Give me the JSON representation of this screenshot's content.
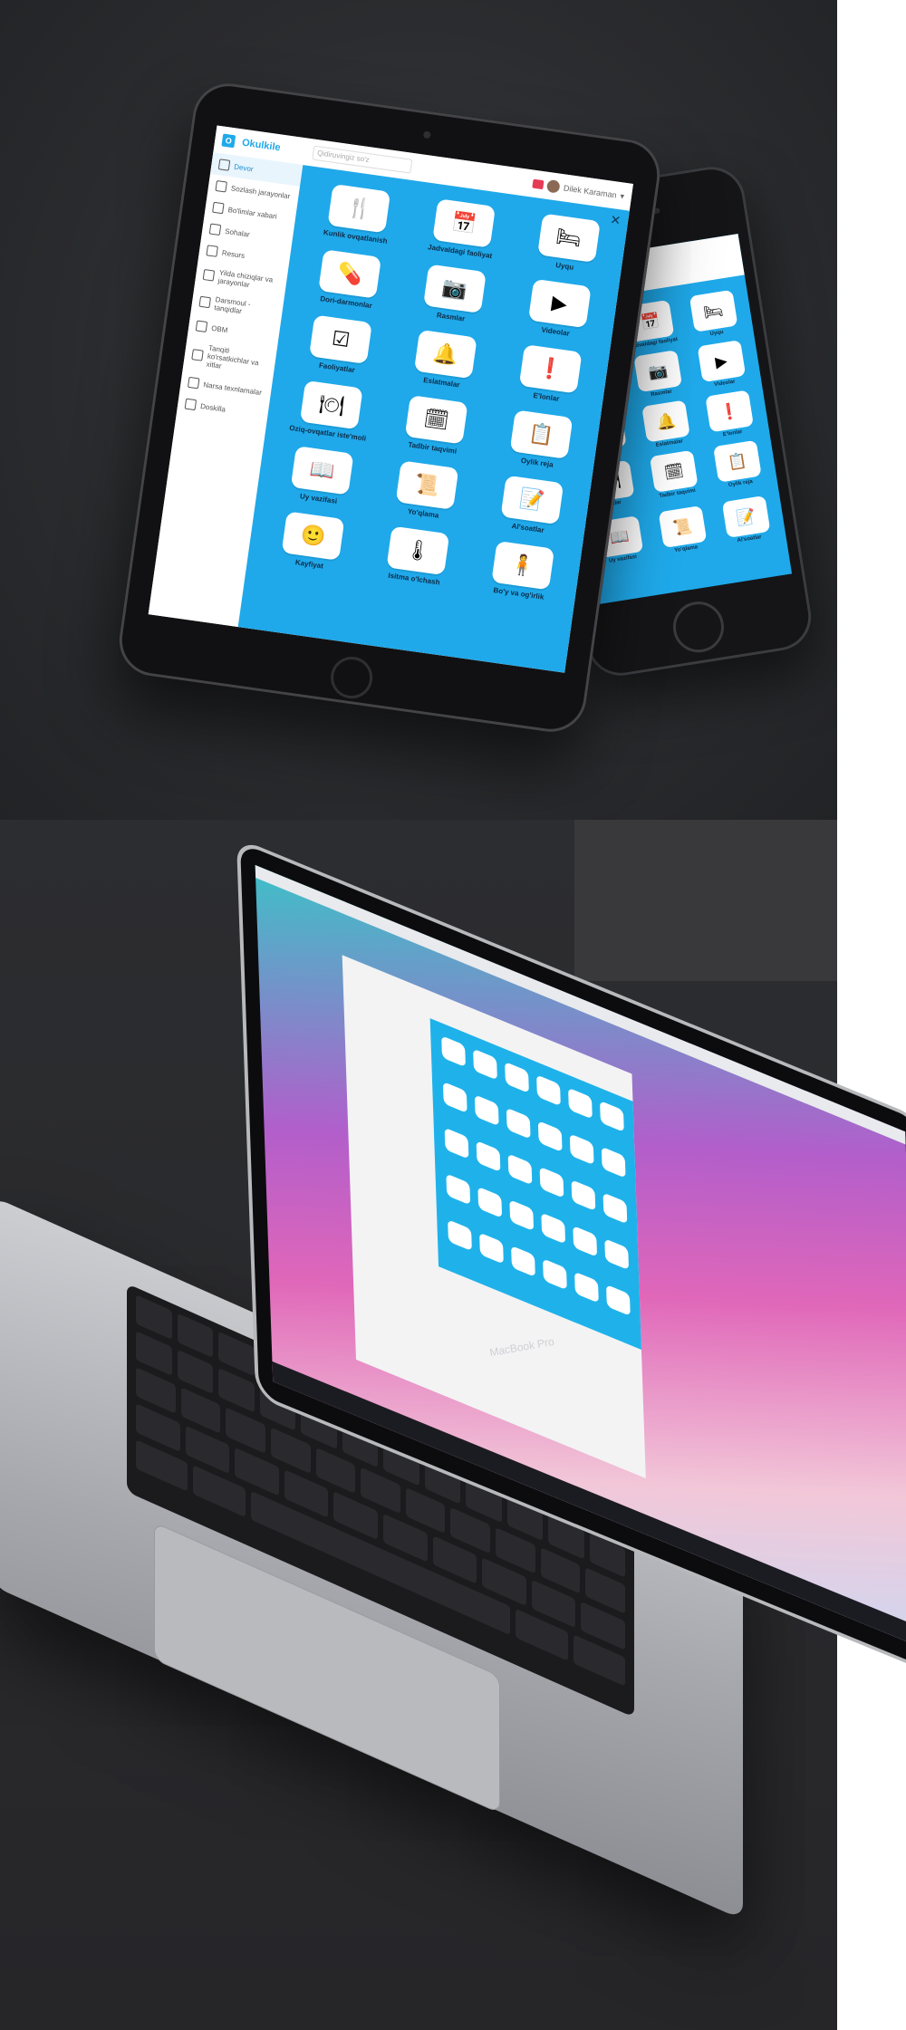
{
  "header": {
    "logo_text": "Okulkile",
    "search_placeholder": "Qidiruvingiz so'z",
    "user_name": "Dilek Karaman"
  },
  "sidebar": {
    "items": [
      {
        "label": "Devor",
        "icon": "wall-icon"
      },
      {
        "label": "Sozlash jarayonlar",
        "icon": "gear-icon"
      },
      {
        "label": "Bo'limlar xabari",
        "icon": "bell-icon"
      },
      {
        "label": "Sohalar",
        "icon": "grid-icon"
      },
      {
        "label": "Resurs",
        "icon": "book-icon"
      },
      {
        "label": "Yilda chiziqlar va jarayonlar",
        "icon": "chart-icon"
      },
      {
        "label": "Darsmoul - tanqidlar",
        "icon": "monitor-icon"
      },
      {
        "label": "OBM",
        "icon": "puzzle-icon"
      },
      {
        "label": "Tanqiti ko'rsatkichlar va xitlar",
        "icon": "list-icon"
      },
      {
        "label": "Narsa texnlamalar",
        "icon": "chat-icon"
      },
      {
        "label": "Doskilla",
        "icon": "board-icon"
      }
    ]
  },
  "activities": [
    {
      "label": "Kunlik ovqatlanish",
      "icon": "fork-knife-icon",
      "glyph": "🍴"
    },
    {
      "label": "Jadvaldagi faoliyat",
      "icon": "calendar-icon",
      "glyph": "📅"
    },
    {
      "label": "Uyqu",
      "icon": "bed-icon",
      "glyph": "🛏"
    },
    {
      "label": "Dori-darmonlar",
      "icon": "pill-icon",
      "glyph": "💊"
    },
    {
      "label": "Rasmlar",
      "icon": "camera-icon",
      "glyph": "📷"
    },
    {
      "label": "Videolar",
      "icon": "video-icon",
      "glyph": "▶"
    },
    {
      "label": "Faoliyatlar",
      "icon": "checklist-icon",
      "glyph": "☑"
    },
    {
      "label": "Eslatmalar",
      "icon": "alarm-bell-icon",
      "glyph": "🔔"
    },
    {
      "label": "E'lonlar",
      "icon": "announcement-icon",
      "glyph": "❗"
    },
    {
      "label": "Oziq-ovqatlar iste'moli",
      "icon": "food-tray-icon",
      "glyph": "🍽"
    },
    {
      "label": "Tadbir taqvimi",
      "icon": "event-calendar-icon",
      "glyph": "🗓"
    },
    {
      "label": "Oylik reja",
      "icon": "monthly-plan-icon",
      "glyph": "📋"
    },
    {
      "label": "Uy vazifasi",
      "icon": "open-book-icon",
      "glyph": "📖"
    },
    {
      "label": "Yo'qlama",
      "icon": "scroll-icon",
      "glyph": "📜"
    },
    {
      "label": "Al'soatlar",
      "icon": "sticky-note-icon",
      "glyph": "📝"
    },
    {
      "label": "Kayfiyat",
      "icon": "smiley-icon",
      "glyph": "🙂"
    },
    {
      "label": "Isitma o'lchash",
      "icon": "thermometer-icon",
      "glyph": "🌡"
    },
    {
      "label": "Bo'y va og'irlik",
      "icon": "body-icon",
      "glyph": "🧍"
    }
  ],
  "laptop": {
    "brand": "MacBook Pro"
  },
  "colors": {
    "accent": "#1fa9ea",
    "tile_text": "#0e2a46",
    "background_dark": "#2b2c2f"
  }
}
